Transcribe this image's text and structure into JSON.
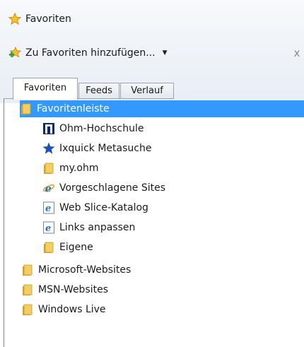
{
  "header": {
    "title": "Favoriten",
    "add_label": "Zu Favoriten hinzufügen...",
    "close_glyph": "x"
  },
  "tabs": [
    {
      "label": "Favoriten",
      "active": true
    },
    {
      "label": "Feeds",
      "active": false
    },
    {
      "label": "Verlauf",
      "active": false
    }
  ],
  "tree": [
    {
      "label": "Favoritenleiste",
      "icon": "folder-icon",
      "level": 0,
      "selected": true
    },
    {
      "label": "Ohm-Hochschule",
      "icon": "ohm-logo-icon",
      "level": 1,
      "selected": false
    },
    {
      "label": "Ixquick Metasuche",
      "icon": "star-icon",
      "level": 1,
      "selected": false
    },
    {
      "label": "my.ohm",
      "icon": "folder-icon",
      "level": 1,
      "selected": false
    },
    {
      "label": "Vorgeschlagene Sites",
      "icon": "ie-icon",
      "level": 1,
      "selected": false
    },
    {
      "label": "Web Slice-Katalog",
      "icon": "ie-page-icon",
      "level": 1,
      "selected": false
    },
    {
      "label": "Links anpassen",
      "icon": "ie-page-icon",
      "level": 1,
      "selected": false
    },
    {
      "label": "Eigene",
      "icon": "folder-icon",
      "level": 1,
      "selected": false
    },
    {
      "label": "Microsoft-Websites",
      "icon": "folder-icon",
      "level": 0,
      "selected": false
    },
    {
      "label": "MSN-Websites",
      "icon": "folder-icon",
      "level": 0,
      "selected": false
    },
    {
      "label": "Windows Live",
      "icon": "folder-icon",
      "level": 0,
      "selected": false
    }
  ],
  "colors": {
    "selection": "#3399ff",
    "folder": "#e8b93c",
    "star": "#f2b01e",
    "ie_blue": "#1e6fd0"
  }
}
